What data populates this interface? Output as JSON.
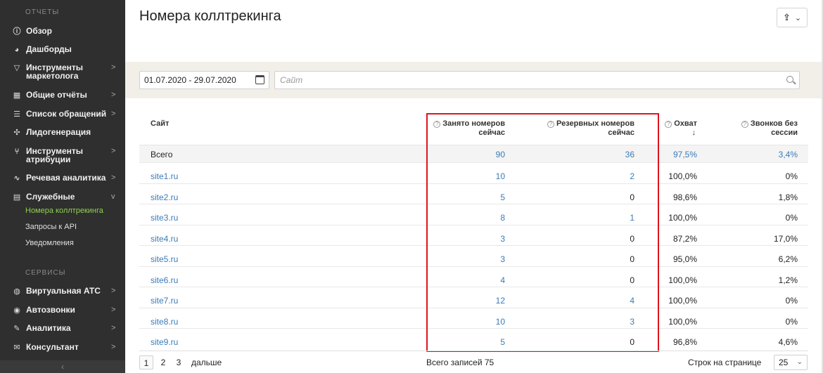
{
  "sidebar": {
    "section_reports": "ОТЧЕТЫ",
    "section_services": "СЕРВИСЫ",
    "items": [
      {
        "label": "Обзор",
        "icon": "info-square-icon",
        "arrow": ""
      },
      {
        "label": "Дашборды",
        "icon": "pie-chart-icon",
        "arrow": ""
      },
      {
        "label": "Инструменты маркетолога",
        "icon": "funnel-icon",
        "arrow": ">"
      },
      {
        "label": "Общие отчёты",
        "icon": "table-icon",
        "arrow": ">"
      },
      {
        "label": "Список обращений",
        "icon": "list-icon",
        "arrow": ">"
      },
      {
        "label": "Лидогенерация",
        "icon": "network-icon",
        "arrow": ""
      },
      {
        "label": "Инструменты атрибуции",
        "icon": "branch-icon",
        "arrow": ">"
      },
      {
        "label": "Речевая аналитика",
        "icon": "waveform-icon",
        "arrow": ">"
      },
      {
        "label": "Служебные",
        "icon": "calendar-icon",
        "arrow": "v"
      }
    ],
    "sub_items": [
      "Номера коллтрекинга",
      "Запросы к API",
      "Уведомления"
    ],
    "service_items": [
      {
        "label": "Виртуальная АТС",
        "icon": "phone-icon",
        "arrow": ">"
      },
      {
        "label": "Автозвонки",
        "icon": "autocall-icon",
        "arrow": ">"
      },
      {
        "label": "Аналитика",
        "icon": "analytics-icon",
        "arrow": ">"
      },
      {
        "label": "Консультант",
        "icon": "chat-icon",
        "arrow": ">"
      }
    ],
    "collapse": "‹"
  },
  "header": {
    "title": "Номера коллтрекинга"
  },
  "filters": {
    "date_range": "01.07.2020 - 29.07.2020",
    "site_placeholder": "Сайт"
  },
  "table": {
    "headers": {
      "site": "Сайт",
      "occupied_line1": "Занято номеров",
      "occupied_line2": "сейчас",
      "reserve": "Резервных номеров сейчас",
      "coverage": "Охват",
      "coverage_sort": "↓",
      "no_session_line1": "Звонков без",
      "no_session_line2": "сессии"
    },
    "total": {
      "site": "Всего",
      "occupied": "90",
      "reserve": "36",
      "coverage": "97,5%",
      "no_session": "3,4%"
    },
    "rows": [
      {
        "site": "site1.ru",
        "occupied": "10",
        "reserve": "2",
        "coverage": "100,0%",
        "no_session": "0%"
      },
      {
        "site": "site2.ru",
        "occupied": "5",
        "reserve": "0",
        "coverage": "98,6%",
        "no_session": "1,8%"
      },
      {
        "site": "site3.ru",
        "occupied": "8",
        "reserve": "1",
        "coverage": "100,0%",
        "no_session": "0%"
      },
      {
        "site": "site4.ru",
        "occupied": "3",
        "reserve": "0",
        "coverage": "87,2%",
        "no_session": "17,0%"
      },
      {
        "site": "site5.ru",
        "occupied": "3",
        "reserve": "0",
        "coverage": "95,0%",
        "no_session": "6,2%"
      },
      {
        "site": "site6.ru",
        "occupied": "4",
        "reserve": "0",
        "coverage": "100,0%",
        "no_session": "1,2%"
      },
      {
        "site": "site7.ru",
        "occupied": "12",
        "reserve": "4",
        "coverage": "100,0%",
        "no_session": "0%"
      },
      {
        "site": "site8.ru",
        "occupied": "10",
        "reserve": "3",
        "coverage": "100,0%",
        "no_session": "0%"
      },
      {
        "site": "site9.ru",
        "occupied": "5",
        "reserve": "0",
        "coverage": "96,8%",
        "no_session": "4,6%"
      }
    ]
  },
  "footer": {
    "pages": [
      "1",
      "2",
      "3"
    ],
    "next": "дальше",
    "total_records": "Всего записей 75",
    "per_page_label": "Строк на странице",
    "per_page_value": "25"
  },
  "colors": {
    "sidebar_bg": "#2f2f2f",
    "active_sub": "#8fd14f",
    "link": "#3a7ab8",
    "highlight": "#e0141c"
  }
}
